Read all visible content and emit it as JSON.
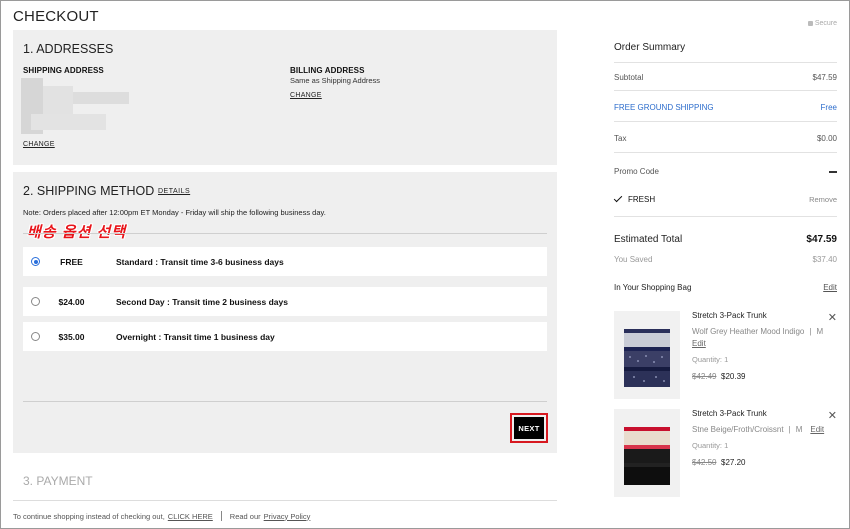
{
  "page": {
    "title": "CHECKOUT",
    "secure": "Secure"
  },
  "addresses": {
    "heading": "1. ADDRESSES",
    "shipping_label": "SHIPPING ADDRESS",
    "billing_label": "BILLING ADDRESS",
    "billing_value": "Same as Shipping Address",
    "change_shipping": "CHANGE",
    "change_billing": "CHANGE"
  },
  "shipping": {
    "heading": "2. SHIPPING METHOD",
    "details_link": "DETAILS",
    "note": "Note: Orders placed after 12:00pm ET Monday - Friday will ship the following business day.",
    "annotation": "배송 옵션 선택",
    "options": [
      {
        "price": "FREE",
        "description": "Standard : Transit time 3-6 business days",
        "selected": true
      },
      {
        "price": "$24.00",
        "description": "Second Day : Transit time 2 business days",
        "selected": false
      },
      {
        "price": "$35.00",
        "description": "Overnight : Transit time 1 business day",
        "selected": false
      }
    ],
    "next_label": "NEXT"
  },
  "payment": {
    "heading": "3. PAYMENT"
  },
  "footer": {
    "continue_text": "To continue shopping instead of checking out,",
    "click_here": "CLICK HERE",
    "read_our": "Read our",
    "privacy_policy": "Privacy Policy"
  },
  "summary": {
    "title": "Order Summary",
    "subtotal_label": "Subtotal",
    "subtotal_value": "$47.59",
    "shipping_label": "FREE GROUND SHIPPING",
    "shipping_value": "Free",
    "tax_label": "Tax",
    "tax_value": "$0.00",
    "promo_label": "Promo Code",
    "promo_code": "FRESH",
    "promo_remove": "Remove",
    "estimated_label": "Estimated Total",
    "estimated_value": "$47.59",
    "saved_label": "You Saved",
    "saved_value": "$37.40",
    "bag_label": "In Your Shopping Bag",
    "bag_edit": "Edit"
  },
  "bag_items": [
    {
      "name": "Stretch 3-Pack Trunk",
      "variant": "Wolf Grey Heather Mood Indigo",
      "size": "M",
      "edit": "Edit",
      "quantity": "Quantity: 1",
      "old_price": "$42.49",
      "new_price": "$20.39"
    },
    {
      "name": "Stretch 3-Pack Trunk",
      "variant": "Stne Beige/Froth/Croissnt",
      "size": "M",
      "edit": "Edit",
      "quantity": "Quantity: 1",
      "old_price": "$42.50",
      "new_price": "$27.20"
    }
  ],
  "colors": {
    "accent_blue": "#2d6dcc",
    "highlight_red": "#d71920",
    "annotation_red": "#e8141a"
  }
}
